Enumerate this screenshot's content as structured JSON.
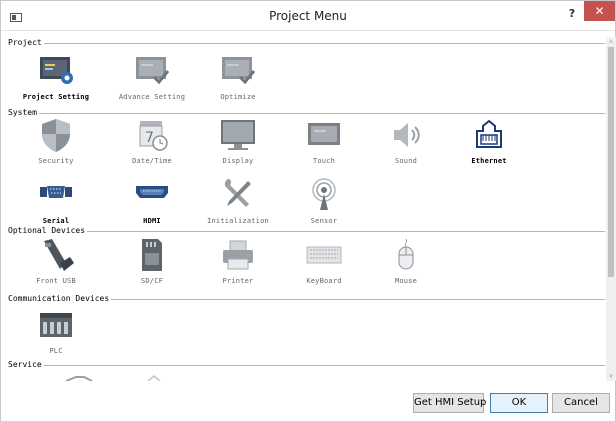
{
  "window": {
    "title": "Project Menu",
    "help_label": "?",
    "close_label": "✕"
  },
  "sections": {
    "project": {
      "label": "Project",
      "items": [
        {
          "label": "Project Setting",
          "icon": "project-setting-icon",
          "active": true
        },
        {
          "label": "Advance Setting",
          "icon": "advance-setting-icon",
          "active": false
        },
        {
          "label": "Optimize",
          "icon": "optimize-icon",
          "active": false
        }
      ]
    },
    "system": {
      "label": "System",
      "items": [
        {
          "label": "Security",
          "icon": "shield-icon",
          "active": false
        },
        {
          "label": "Date/Time",
          "icon": "calendar-clock-icon",
          "active": false
        },
        {
          "label": "Display",
          "icon": "monitor-icon",
          "active": false
        },
        {
          "label": "Touch",
          "icon": "touch-screen-icon",
          "active": false
        },
        {
          "label": "Sound",
          "icon": "speaker-icon",
          "active": false
        },
        {
          "label": "Ethernet",
          "icon": "ethernet-port-icon",
          "active": true
        },
        {
          "label": "Serial",
          "icon": "serial-port-icon",
          "active": true
        },
        {
          "label": "HDMI",
          "icon": "hdmi-port-icon",
          "active": true
        },
        {
          "label": "Initialization",
          "icon": "tools-icon",
          "active": false
        },
        {
          "label": "Sensor",
          "icon": "sensor-icon",
          "active": false
        }
      ]
    },
    "optional_devices": {
      "label": "Optional Devices",
      "items": [
        {
          "label": "Front USB",
          "icon": "usb-plug-icon",
          "active": false
        },
        {
          "label": "SD/CF",
          "icon": "sd-card-icon",
          "active": false
        },
        {
          "label": "Printer",
          "icon": "printer-icon",
          "active": false
        },
        {
          "label": "KeyBoard",
          "icon": "keyboard-icon",
          "active": false
        },
        {
          "label": "Mouse",
          "icon": "mouse-icon",
          "active": false
        }
      ]
    },
    "communication_devices": {
      "label": "Communication Devices",
      "items": [
        {
          "label": "PLC",
          "icon": "plc-icon",
          "active": false
        }
      ]
    },
    "service": {
      "label": "Service"
    }
  },
  "footer": {
    "get_hmi_setup": "Get HMI Setup",
    "ok": "OK",
    "cancel": "Cancel"
  }
}
